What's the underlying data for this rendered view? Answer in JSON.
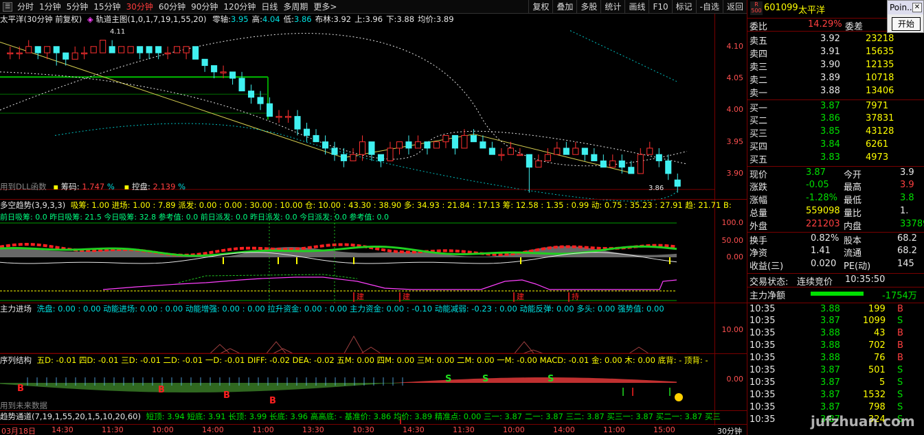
{
  "toolbar": {
    "items": [
      "分时",
      "1分钟",
      "5分钟",
      "15分钟",
      "30分钟",
      "60分钟",
      "90分钟",
      "120分钟",
      "日线",
      "多周期",
      "更多>"
    ],
    "active": "30分钟",
    "right_items": [
      "复权",
      "叠加",
      "多股",
      "统计",
      "画线",
      "F10",
      "标记",
      "-自选",
      "返回"
    ]
  },
  "main_panel": {
    "title": "太平洋(30分钟 前复权)",
    "indicator_name": "轨道主图(1,0,1,7,19,1,55,20)",
    "indicator_items": [
      {
        "label": "零轴:",
        "value": "3.95",
        "color": "#00e0e0"
      },
      {
        "label": "高:",
        "value": "4.04",
        "color": "#00e0e0"
      },
      {
        "label": "低:",
        "value": "3.86",
        "color": "#00e0e0"
      },
      {
        "label": "布林:",
        "value": "3.92",
        "color": "#e8e8e8"
      },
      {
        "label": "上:",
        "value": "3.96",
        "color": "#e8e8e8"
      },
      {
        "label": "下:",
        "value": "3.88",
        "color": "#e8e8e8"
      },
      {
        "label": "均价:",
        "value": "3.89",
        "color": "#e8e8e8"
      }
    ],
    "high_mark": "4.11",
    "low_mark": "3.86",
    "dll_text": "用到DLL函数",
    "chip_label": "筹码:",
    "chip_value": "1.747",
    "chip_unit": "%",
    "control_label": "控盘:",
    "control_value": "2.139",
    "control_unit": "%",
    "yticks": [
      "4.10",
      "4.05",
      "4.00",
      "3.95",
      "3.90"
    ]
  },
  "panel2": {
    "title": "多空趋势(3,9,3,3)",
    "items": "吸筹: 1.00  进场: 1.00 : 7.89  派发: 0.00 : 0.00 : 30.00 : 10.00  仓: 10.00 : 43.30 : 38.90  多: 34.93 : 21.84 : 17.13  筹: 12.58 : 1.35 : 0.99  动: 0.75 : 35.23 : 27.91  趋: 21.71  B:",
    "sub": "前日吸筹: 0.0     昨日吸筹: 21.5     今日吸筹: 32.8     参考值: 0.0     前日派发: 0.0     昨日派发: 0.0     今日派发: 0.0     参考值: 0.0",
    "yticks": [
      "100.0",
      "50.00",
      "0.00"
    ],
    "build_labels": [
      "建",
      "建",
      "建",
      "持"
    ]
  },
  "panel3": {
    "title": "主力进场",
    "items": "洗盘: 0.00 : 0.00  动能进场: 0.00 : 0.00  动能增强: 0.00 : 0.00  拉升资金: 0.00 : 0.00  主力资金: 0.00 : -0.10  动能减弱: -0.23 : 0.00  动能反弹: 0.00  多头: 0.00  强势值: 0.00",
    "yticks": [
      "10.00"
    ]
  },
  "panel4": {
    "title": "序列结构",
    "items": "五D: -0.01  四D: -0.01  三D: -0.01  二D: -0.01  一D: -0.01  DIFF: -0.02  DEA: -0.02  五M: 0.00  四M: 0.00  三M: 0.00  二M: 0.00  一M: -0.00  MACD: -0.01  金: 0.00  木: 0.00  底背: -  顶背: -",
    "future_text": "用到未来数据",
    "yticks": [
      "0.00"
    ],
    "b_labels": [
      "B",
      "B",
      "B",
      "B"
    ],
    "s_labels": [
      "S",
      "S",
      "S"
    ]
  },
  "panel5": {
    "title": "趋势通道(7,19,1,55,20,1,5,10,20,60)",
    "items": "短顶: 3.94  短底: 3.91  长顶: 3.99  长底: 3.96  高高底: - 基准价: 3.86  均价: 3.89  精准点: 0.00  三一: 3.87  二一: 3.87  三二: 3.87  买三一: 3.87  买二一: 3.87  买三"
  },
  "time_axis": {
    "labels": [
      "03月18日",
      "14:30",
      "11:30",
      "10:00",
      "14:00",
      "11:00",
      "13:30",
      "10:30",
      "14:30",
      "11:30",
      "10:00",
      "14:00",
      "11:00",
      "15:00"
    ],
    "period": "30分钟"
  },
  "stock": {
    "code": "601099",
    "name": "太平洋",
    "badge_top": "R",
    "badge_bottom": "500"
  },
  "order_book": {
    "weibi_label": "委比",
    "weibi_value": "14.29%",
    "weicha_label": "委差",
    "asks": [
      {
        "label": "卖五",
        "price": "3.92",
        "vol": "23218"
      },
      {
        "label": "卖四",
        "price": "3.91",
        "vol": "15635"
      },
      {
        "label": "卖三",
        "price": "3.90",
        "vol": "12135"
      },
      {
        "label": "卖二",
        "price": "3.89",
        "vol": "10718"
      },
      {
        "label": "卖一",
        "price": "3.88",
        "vol": "13406"
      }
    ],
    "bids": [
      {
        "label": "买一",
        "price": "3.87",
        "vol": "7971"
      },
      {
        "label": "买二",
        "price": "3.86",
        "vol": "37831"
      },
      {
        "label": "买三",
        "price": "3.85",
        "vol": "43128"
      },
      {
        "label": "买四",
        "price": "3.84",
        "vol": "6261"
      },
      {
        "label": "买五",
        "price": "3.83",
        "vol": "4973"
      }
    ]
  },
  "quote": [
    {
      "l1": "现价",
      "v1": "3.87",
      "c1": "#00e000",
      "l2": "今开",
      "v2": "3.9",
      "c2": "#e8e8e8"
    },
    {
      "l1": "涨跌",
      "v1": "-0.05",
      "c1": "#00e000",
      "l2": "最高",
      "v2": "3.9",
      "c2": "#ff4040"
    },
    {
      "l1": "涨幅",
      "v1": "-1.28%",
      "c1": "#00e000",
      "l2": "最低",
      "v2": "3.8",
      "c2": "#00e000"
    },
    {
      "l1": "总量",
      "v1": "559098",
      "c1": "#ffff00",
      "l2": "量比",
      "v2": "1.",
      "c2": "#e8e8e8"
    },
    {
      "l1": "外盘",
      "v1": "221203",
      "c1": "#ff4040",
      "l2": "内盘",
      "v2": "33789",
      "c2": "#00e000"
    }
  ],
  "fundamentals": [
    {
      "l1": "换手",
      "v1": "0.82%",
      "l2": "股本",
      "v2": "68.2"
    },
    {
      "l1": "净资",
      "v1": "1.41",
      "l2": "流通",
      "v2": "68.2"
    },
    {
      "l1": "收益(三)",
      "v1": "0.020",
      "l2": "PE(动)",
      "v2": "145"
    }
  ],
  "trade_status": {
    "label": "交易状态:",
    "value": "连续竞价",
    "time": "10:35:50"
  },
  "main_net": {
    "label": "主力净额",
    "value": "-1754万",
    "bar_fraction": 0.55
  },
  "ticks": [
    {
      "t": "10:35",
      "p": "3.88",
      "v": "199",
      "d": "B"
    },
    {
      "t": "10:35",
      "p": "3.87",
      "v": "1099",
      "d": "S"
    },
    {
      "t": "10:35",
      "p": "3.88",
      "v": "43",
      "d": "B"
    },
    {
      "t": "10:35",
      "p": "3.88",
      "v": "702",
      "d": "B"
    },
    {
      "t": "10:35",
      "p": "3.88",
      "v": "76",
      "d": "B"
    },
    {
      "t": "10:35",
      "p": "3.87",
      "v": "501",
      "d": "S"
    },
    {
      "t": "10:35",
      "p": "3.87",
      "v": "5",
      "d": "S"
    },
    {
      "t": "10:35",
      "p": "3.87",
      "v": "1532",
      "d": "S"
    },
    {
      "t": "10:35",
      "p": "3.87",
      "v": "798",
      "d": "S"
    },
    {
      "t": "10:35",
      "p": "3.87",
      "v": "324",
      "d": "S"
    }
  ],
  "popup": {
    "title": "Poin...",
    "button": "开始"
  },
  "watermark": "jufzhuan.com",
  "chart_data": {
    "type": "candlestick",
    "ylim": [
      3.86,
      4.13
    ],
    "candles": [
      [
        4.09,
        4.09,
        4.1,
        4.08
      ],
      [
        4.09,
        4.09,
        4.1,
        4.08
      ],
      [
        4.09,
        4.1,
        4.11,
        4.09
      ],
      [
        4.1,
        4.09,
        4.1,
        4.08
      ],
      [
        4.09,
        4.1,
        4.1,
        4.08
      ],
      [
        4.1,
        4.09,
        4.1,
        4.07
      ],
      [
        4.09,
        4.08,
        4.09,
        4.07
      ],
      [
        4.08,
        4.09,
        4.1,
        4.08
      ],
      [
        4.09,
        4.09,
        4.1,
        4.08
      ],
      [
        4.09,
        4.1,
        4.1,
        4.09
      ],
      [
        4.09,
        4.11,
        4.11,
        4.09
      ],
      [
        4.1,
        4.09,
        4.11,
        4.09
      ],
      [
        4.09,
        4.1,
        4.1,
        4.09
      ],
      [
        4.09,
        4.1,
        4.1,
        4.09
      ],
      [
        4.1,
        4.09,
        4.1,
        4.08
      ],
      [
        4.1,
        4.09,
        4.1,
        4.08
      ],
      [
        4.1,
        4.09,
        4.1,
        4.08
      ],
      [
        4.09,
        4.09,
        4.1,
        4.08
      ],
      [
        4.09,
        4.1,
        4.1,
        4.09
      ],
      [
        4.09,
        4.1,
        4.1,
        4.08
      ],
      [
        4.1,
        4.08,
        4.1,
        4.08
      ],
      [
        4.08,
        4.07,
        4.08,
        4.06
      ],
      [
        4.07,
        4.06,
        4.07,
        4.05
      ],
      [
        4.06,
        4.06,
        4.07,
        4.05
      ],
      [
        4.06,
        4.05,
        4.06,
        4.04
      ],
      [
        4.05,
        4.03,
        4.06,
        4.03
      ],
      [
        4.03,
        4.02,
        4.04,
        4.01
      ],
      [
        4.02,
        4.01,
        4.03,
        4.0
      ],
      [
        4.01,
        3.99,
        4.02,
        3.99
      ],
      [
        3.99,
        3.99,
        4.0,
        3.98
      ],
      [
        3.99,
        3.99,
        4.0,
        3.98
      ],
      [
        3.99,
        3.97,
        4.0,
        3.96
      ],
      [
        3.97,
        3.96,
        3.98,
        3.95
      ],
      [
        3.96,
        3.95,
        3.97,
        3.95
      ],
      [
        3.95,
        3.94,
        3.96,
        3.93
      ],
      [
        3.94,
        3.93,
        3.95,
        3.92
      ],
      [
        3.93,
        3.92,
        3.94,
        3.91
      ],
      [
        3.92,
        3.93,
        3.94,
        3.92
      ],
      [
        3.93,
        3.95,
        3.96,
        3.92
      ],
      [
        3.95,
        3.93,
        3.95,
        3.92
      ],
      [
        3.93,
        3.92,
        3.93,
        3.91
      ],
      [
        3.92,
        3.94,
        3.95,
        3.92
      ],
      [
        3.94,
        3.95,
        3.95,
        3.93
      ],
      [
        3.95,
        3.94,
        3.96,
        3.93
      ],
      [
        3.94,
        3.95,
        3.96,
        3.94
      ],
      [
        3.95,
        3.94,
        3.95,
        3.93
      ],
      [
        3.94,
        3.95,
        3.95,
        3.94
      ],
      [
        3.95,
        3.96,
        3.96,
        3.94
      ],
      [
        3.96,
        3.94,
        3.96,
        3.93
      ],
      [
        3.94,
        3.96,
        3.97,
        3.94
      ],
      [
        3.96,
        3.95,
        3.97,
        3.95
      ],
      [
        3.95,
        3.94,
        3.96,
        3.94
      ],
      [
        3.94,
        3.93,
        3.95,
        3.93
      ],
      [
        3.93,
        3.93,
        3.94,
        3.92
      ],
      [
        3.93,
        3.94,
        3.95,
        3.93
      ],
      [
        3.93,
        3.93,
        3.94,
        3.93
      ],
      [
        3.93,
        3.91,
        3.93,
        3.87
      ],
      [
        3.91,
        3.92,
        3.93,
        3.91
      ],
      [
        3.92,
        3.93,
        3.94,
        3.92
      ],
      [
        3.93,
        3.94,
        3.95,
        3.93
      ],
      [
        3.94,
        3.93,
        3.95,
        3.93
      ],
      [
        3.93,
        3.94,
        3.95,
        3.93
      ],
      [
        3.94,
        3.93,
        3.94,
        3.92
      ],
      [
        3.93,
        3.92,
        3.94,
        3.92
      ],
      [
        3.92,
        3.91,
        3.93,
        3.91
      ],
      [
        3.91,
        3.92,
        3.93,
        3.91
      ],
      [
        3.92,
        3.91,
        3.93,
        3.9
      ],
      [
        3.91,
        3.9,
        3.92,
        3.9
      ],
      [
        3.9,
        3.93,
        3.94,
        3.9
      ],
      [
        3.93,
        3.94,
        3.95,
        3.93
      ],
      [
        3.93,
        3.92,
        3.94,
        3.91
      ],
      [
        3.92,
        3.9,
        3.93,
        3.89
      ],
      [
        3.89,
        3.88,
        3.9,
        3.87
      ]
    ]
  }
}
